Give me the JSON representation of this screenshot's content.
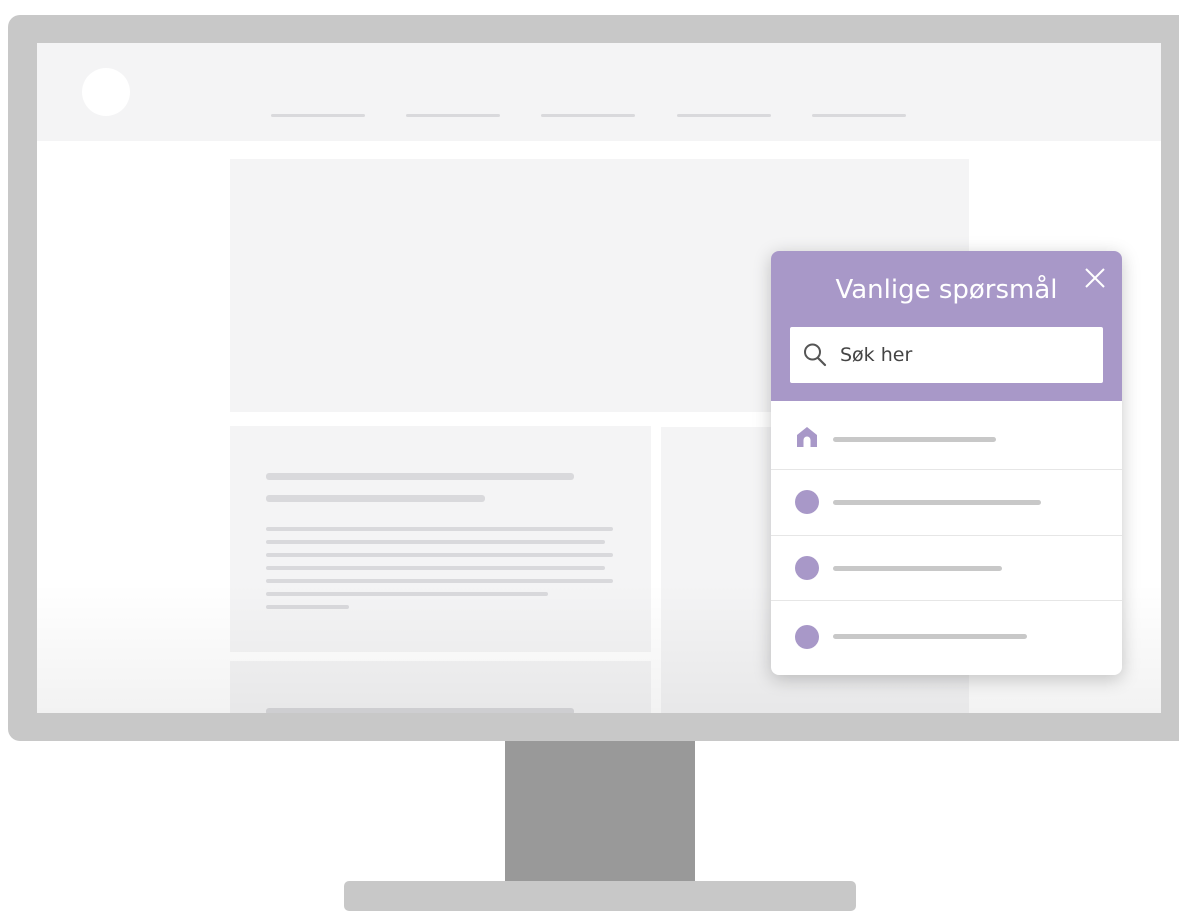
{
  "colors": {
    "accent": "#a898c8",
    "bezel": "#c8c8c8",
    "stand": "#999999",
    "placeholder_bg": "#f4f4f5",
    "placeholder_line": "#d9d9dc"
  },
  "website": {
    "logo_icon": "circle-logo",
    "nav_items": [
      "",
      "",
      "",
      "",
      ""
    ]
  },
  "faq_widget": {
    "title": "Vanlige spørsmål",
    "close_icon": "close-icon",
    "search": {
      "icon": "search-icon",
      "placeholder": "Søk her",
      "value": ""
    },
    "items": [
      {
        "icon": "home-icon",
        "label": ""
      },
      {
        "icon": "dot-icon",
        "label": ""
      },
      {
        "icon": "dot-icon",
        "label": ""
      },
      {
        "icon": "dot-icon",
        "label": ""
      }
    ]
  }
}
